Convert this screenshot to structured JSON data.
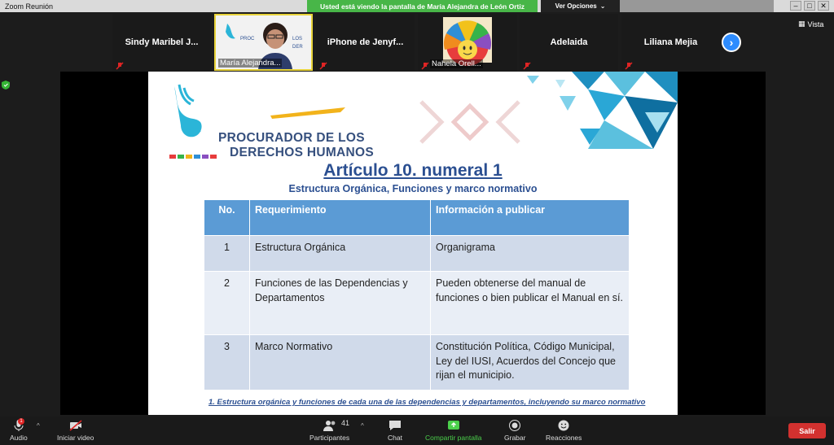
{
  "window": {
    "title": "Zoom Reunión",
    "share_banner": "Usted está viendo la pantalla de María Alejandra de León Ortiz",
    "view_options": "Ver Opciones",
    "view_options_caret": "⌄"
  },
  "participants": [
    {
      "name": "Sindy Maribel J..."
    },
    {
      "name": "María Alejandra..."
    },
    {
      "name": "iPhone de Jenyf..."
    },
    {
      "name": "Nahela Orell..."
    },
    {
      "name": "Adelaida"
    },
    {
      "name": "Liliana Mejia"
    }
  ],
  "vista_label": "Vista",
  "slide": {
    "logo_line1": "PROCURADOR DE LOS",
    "logo_line2": "DERECHOS HUMANOS",
    "title": "Artículo 10. numeral 1",
    "subtitle": "Estructura Orgánica, Funciones y marco normativo",
    "table": {
      "headers": [
        "No.",
        "Requerimiento",
        "Información a publicar"
      ],
      "rows": [
        {
          "no": "1",
          "req": "Estructura Orgánica",
          "info": "Organigrama"
        },
        {
          "no": "2",
          "req": "Funciones de las Dependencias y Departamentos",
          "info": "Pueden obtenerse del manual de funciones o bien publicar el Manual en sí."
        },
        {
          "no": "3",
          "req": "Marco Normativo",
          "info": "Constitución Política, Código Municipal, Ley del IUSI, Acuerdos del Concejo que rijan el municipio."
        }
      ]
    },
    "footnote": "1. Estructura orgánica y funciones de cada una de las dependencias y departamentos, incluyendo su marco normativo"
  },
  "toolbar": {
    "audio": "Audio",
    "audio_badge": "1",
    "video": "Iniciar video",
    "participants": "Participantes",
    "participants_count": "41",
    "chat": "Chat",
    "share": "Compartir pantalla",
    "record": "Grabar",
    "reactions": "Reacciones",
    "exit": "Salir"
  },
  "colors": {
    "share_banner": "#48b648",
    "table_header": "#5b9bd5",
    "slide_title": "#2b4f91",
    "exit": "#d2312f"
  }
}
